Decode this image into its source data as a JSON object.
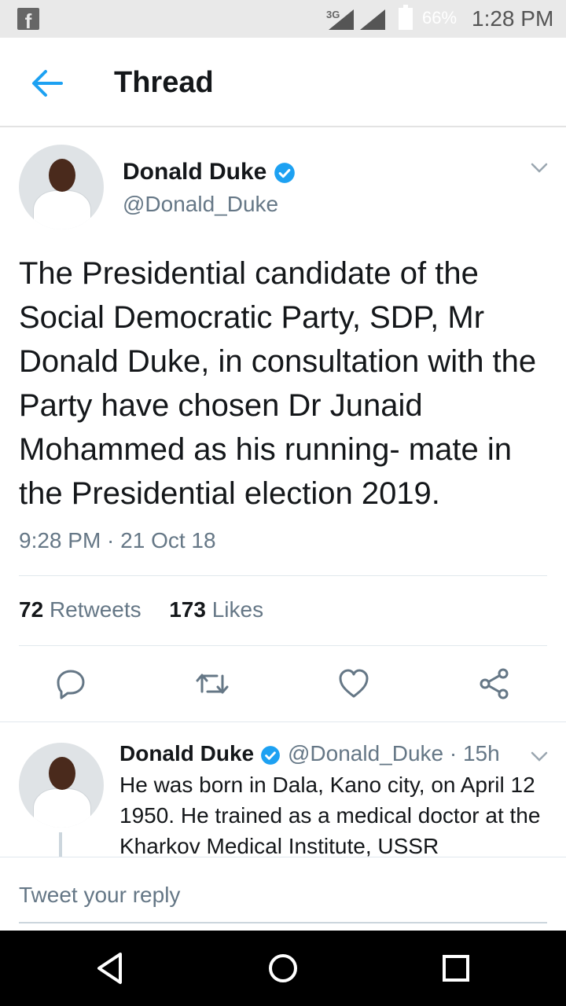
{
  "status_bar": {
    "app_icon": "facebook-icon",
    "network": "3G",
    "battery": "66%",
    "time": "1:28 PM"
  },
  "header": {
    "back_icon": "back-arrow-icon",
    "title": "Thread"
  },
  "tweet": {
    "name": "Donald Duke",
    "handle": "@Donald_Duke",
    "text": "The Presidential candidate of the Social Democratic Party, SDP, Mr Donald Duke, in consultation with the Party have chosen Dr Junaid Mohammed as his running- mate in the Presidential election 2019.",
    "timestamp": "9:28 PM · 21 Oct 18",
    "retweets_count": "72",
    "retweets_label": "Retweets",
    "likes_count": "173",
    "likes_label": "Likes",
    "actions": [
      "reply-icon",
      "retweet-icon",
      "like-icon",
      "share-icon"
    ]
  },
  "reply": {
    "name": "Donald Duke",
    "handle_time": "@Donald_Duke · 15h",
    "text": "He was born in Dala, Kano city, on April 12 1950. He trained as a medical doctor at the Kharkov Medical Institute, USSR"
  },
  "composer": {
    "placeholder": "Tweet your reply"
  },
  "colors": {
    "accent": "#1da1f2",
    "text": "#14171a",
    "secondary": "#657786"
  }
}
